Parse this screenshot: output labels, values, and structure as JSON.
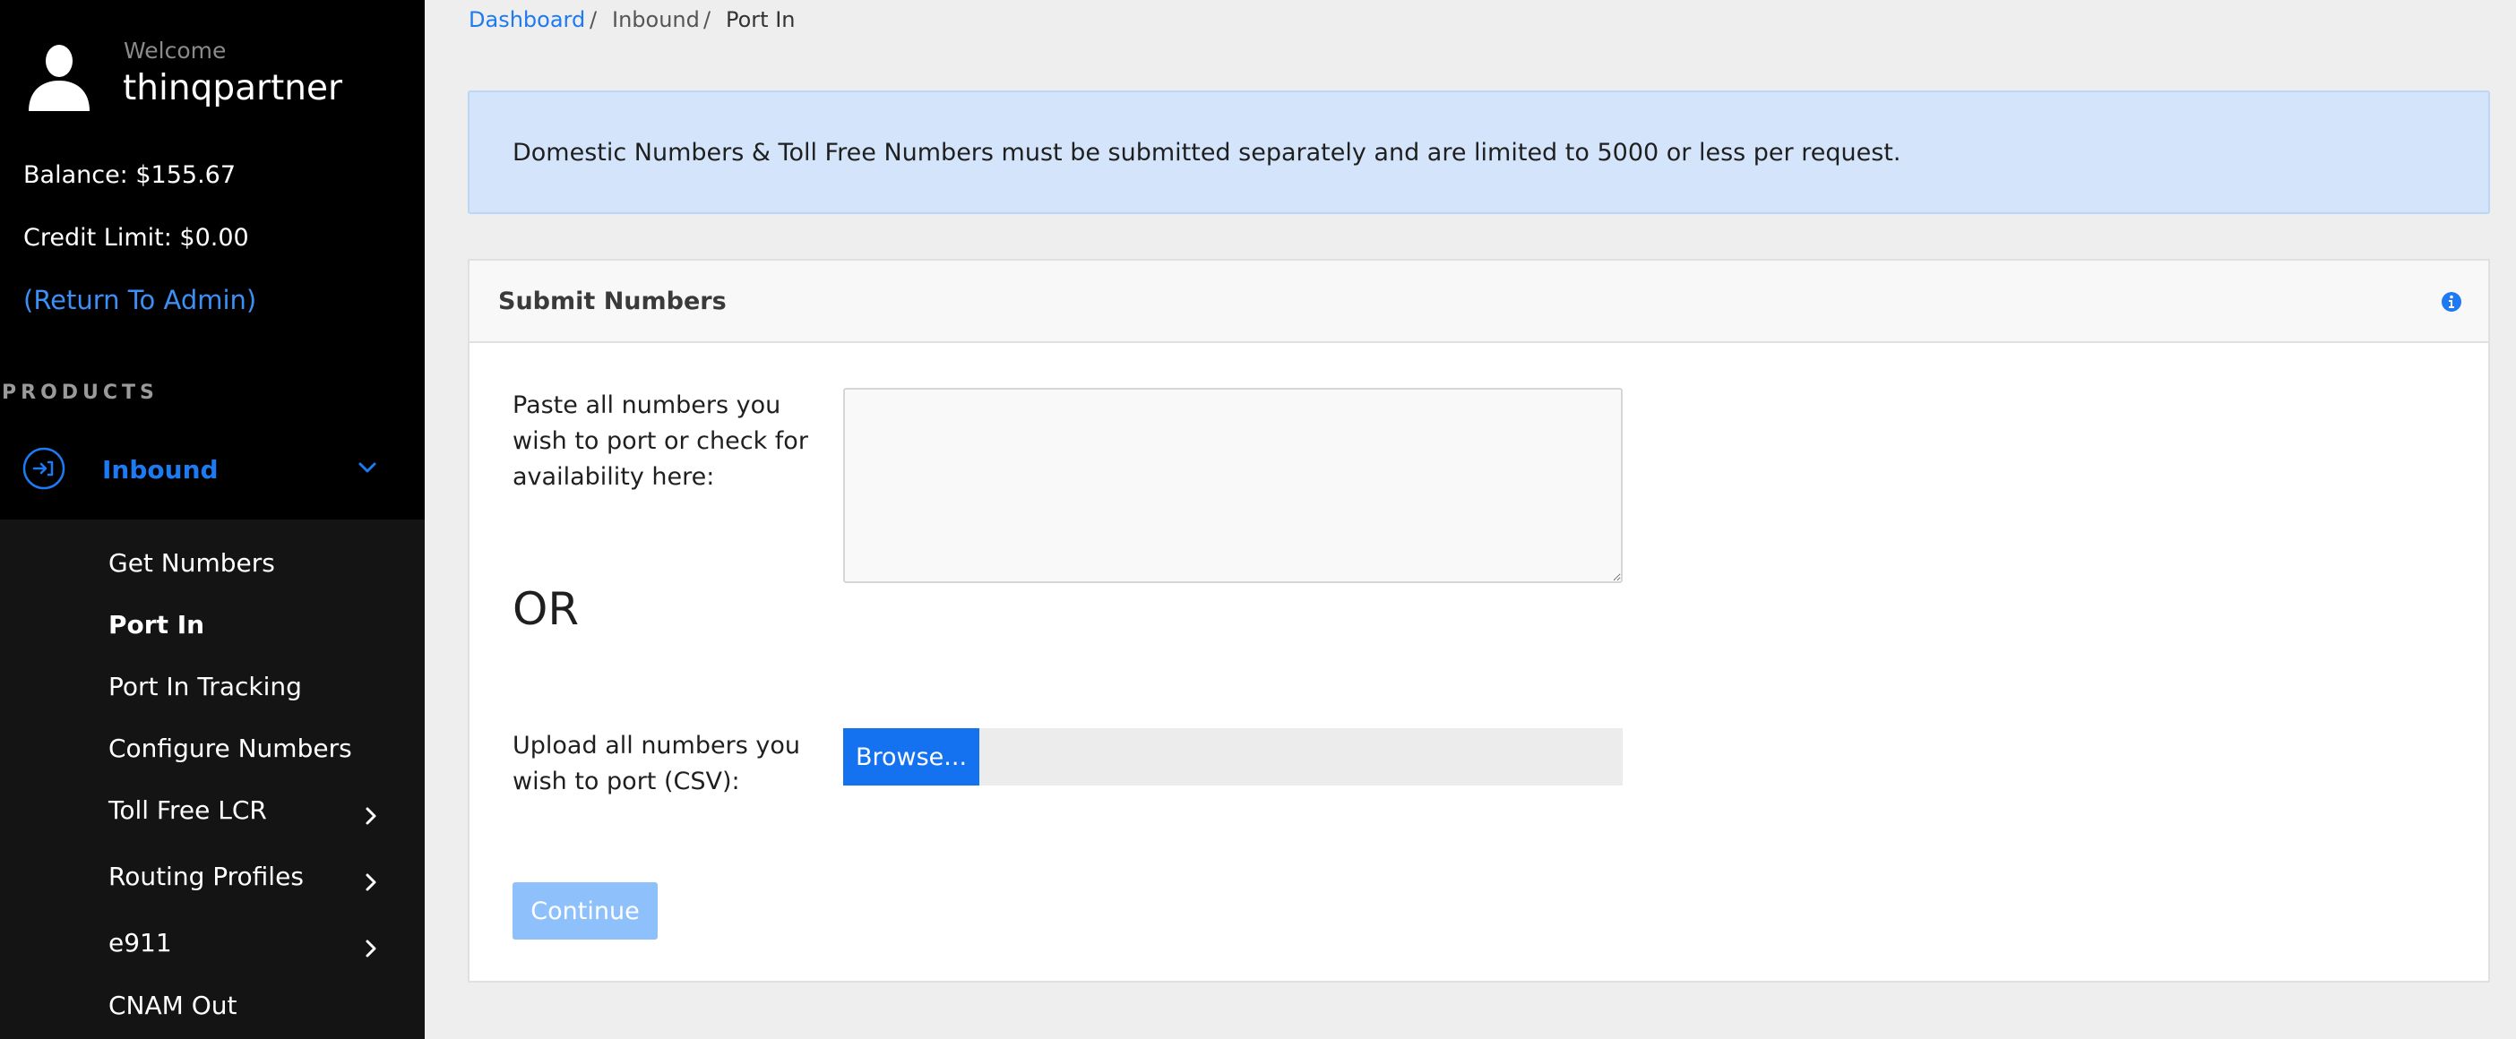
{
  "user": {
    "welcome": "Welcome",
    "username": "thinqpartner",
    "balance": "Balance: $155.67",
    "credit_limit": "Credit Limit: $0.00",
    "return_link": "(Return To Admin)"
  },
  "sidebar": {
    "products_heading": "PRODUCTS",
    "inbound_label": "Inbound",
    "items": [
      {
        "label": "Get Numbers"
      },
      {
        "label": "Port In",
        "active": true
      },
      {
        "label": "Port In Tracking"
      },
      {
        "label": "Configure Numbers"
      },
      {
        "label": "Toll Free LCR",
        "has_submenu": true
      },
      {
        "label": "Routing Profiles",
        "has_submenu": true
      },
      {
        "label": "e911",
        "has_submenu": true
      },
      {
        "label": "CNAM Out"
      }
    ]
  },
  "breadcrumb": {
    "dashboard": "Dashboard",
    "sep": "/",
    "inbound": "Inbound",
    "current": "Port In"
  },
  "alert": {
    "text": "Domestic Numbers & Toll Free Numbers must be submitted separately and are limited to 5000 or less per request."
  },
  "card": {
    "title": "Submit Numbers",
    "paste_label": "Paste all numbers you wish to port or check for availability here:",
    "paste_value": "",
    "or_text": "OR",
    "upload_label": "Upload all numbers you wish to port (CSV):",
    "browse_label": "Browse...",
    "continue_label": "Continue"
  },
  "colors": {
    "accent": "#1d7af3",
    "sidebar_bg": "#000000",
    "submenu_bg": "#141414",
    "alert_bg": "#d4e5fb",
    "continue_disabled": "#8ec0fb"
  },
  "icons": {
    "avatar": "user-silhouette-icon",
    "inbound": "arrow-in-circle-icon",
    "expand": "chevron-down-icon",
    "submenu": "chevron-right-icon",
    "info": "info-circle-icon"
  }
}
